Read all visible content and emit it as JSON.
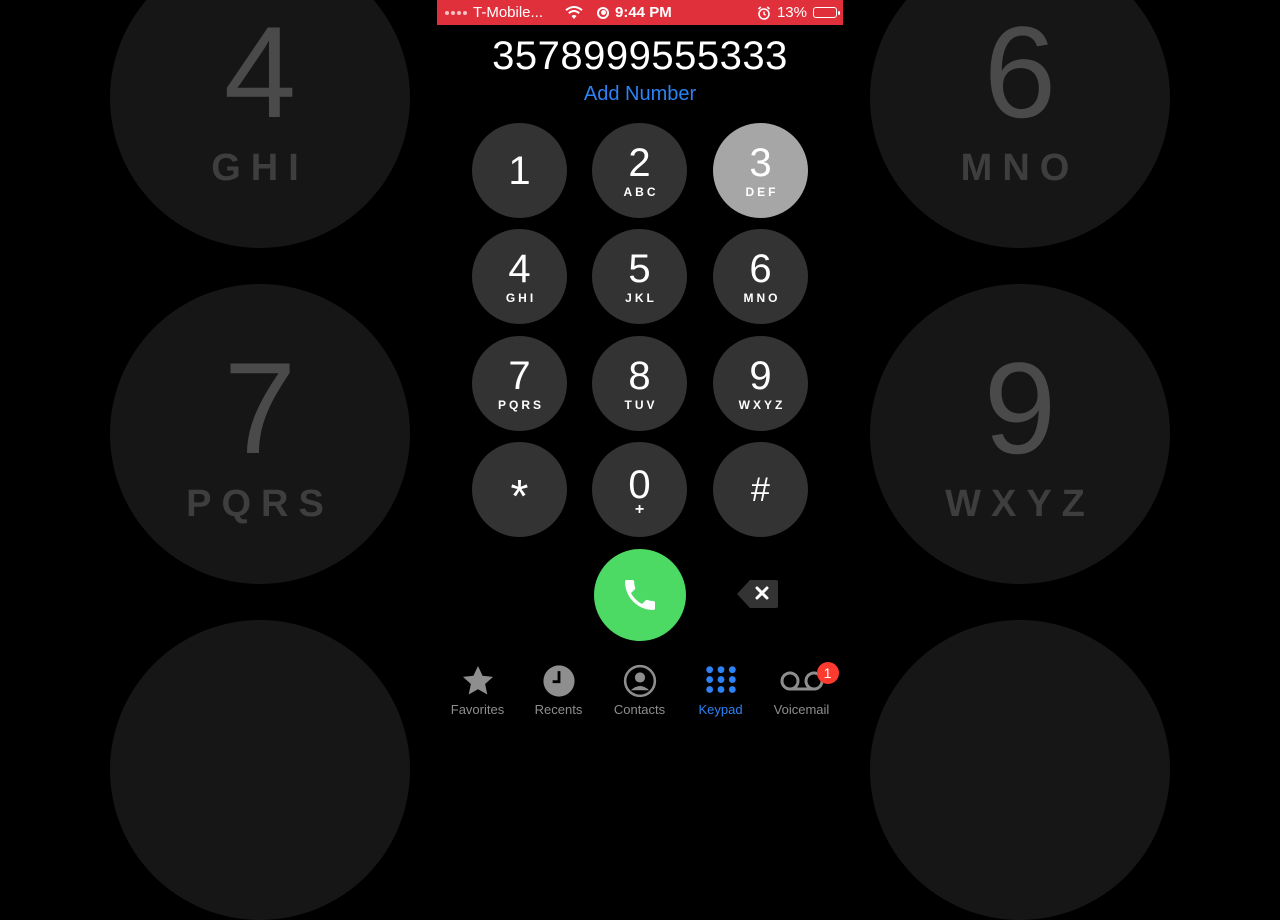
{
  "background_keys": [
    {
      "digit": "4",
      "letters": "GHI"
    },
    {
      "digit": "6",
      "letters": "MNO"
    },
    {
      "digit": "7",
      "letters": "PQRS"
    },
    {
      "digit": "9",
      "letters": "WXYZ"
    }
  ],
  "status_bar": {
    "carrier": "T-Mobile...",
    "time": "9:44 PM",
    "battery_percent": "13%",
    "battery_level": 0.13,
    "background_color": "#e0303b"
  },
  "dialer": {
    "dialed_number": "3578999555333",
    "add_number_label": "Add Number",
    "accent_color": "#2d82f5"
  },
  "keypad": {
    "keys": [
      {
        "digit": "1",
        "letters": ""
      },
      {
        "digit": "2",
        "letters": "ABC"
      },
      {
        "digit": "3",
        "letters": "DEF",
        "pressed": true
      },
      {
        "digit": "4",
        "letters": "GHI"
      },
      {
        "digit": "5",
        "letters": "JKL"
      },
      {
        "digit": "6",
        "letters": "MNO"
      },
      {
        "digit": "7",
        "letters": "PQRS"
      },
      {
        "digit": "8",
        "letters": "TUV"
      },
      {
        "digit": "9",
        "letters": "WXYZ"
      },
      {
        "digit": "*",
        "letters": ""
      },
      {
        "digit": "0",
        "letters": "+"
      },
      {
        "digit": "#",
        "letters": ""
      }
    ]
  },
  "actions": {
    "call_icon": "phone-icon",
    "delete_icon": "delete-icon",
    "call_color": "#4cd964"
  },
  "tab_bar": {
    "tabs": [
      {
        "label": "Favorites",
        "icon": "star-icon"
      },
      {
        "label": "Recents",
        "icon": "clock-icon"
      },
      {
        "label": "Contacts",
        "icon": "person-icon"
      },
      {
        "label": "Keypad",
        "icon": "keypad-icon",
        "active": true
      },
      {
        "label": "Voicemail",
        "icon": "voicemail-icon",
        "badge": "1"
      }
    ]
  }
}
